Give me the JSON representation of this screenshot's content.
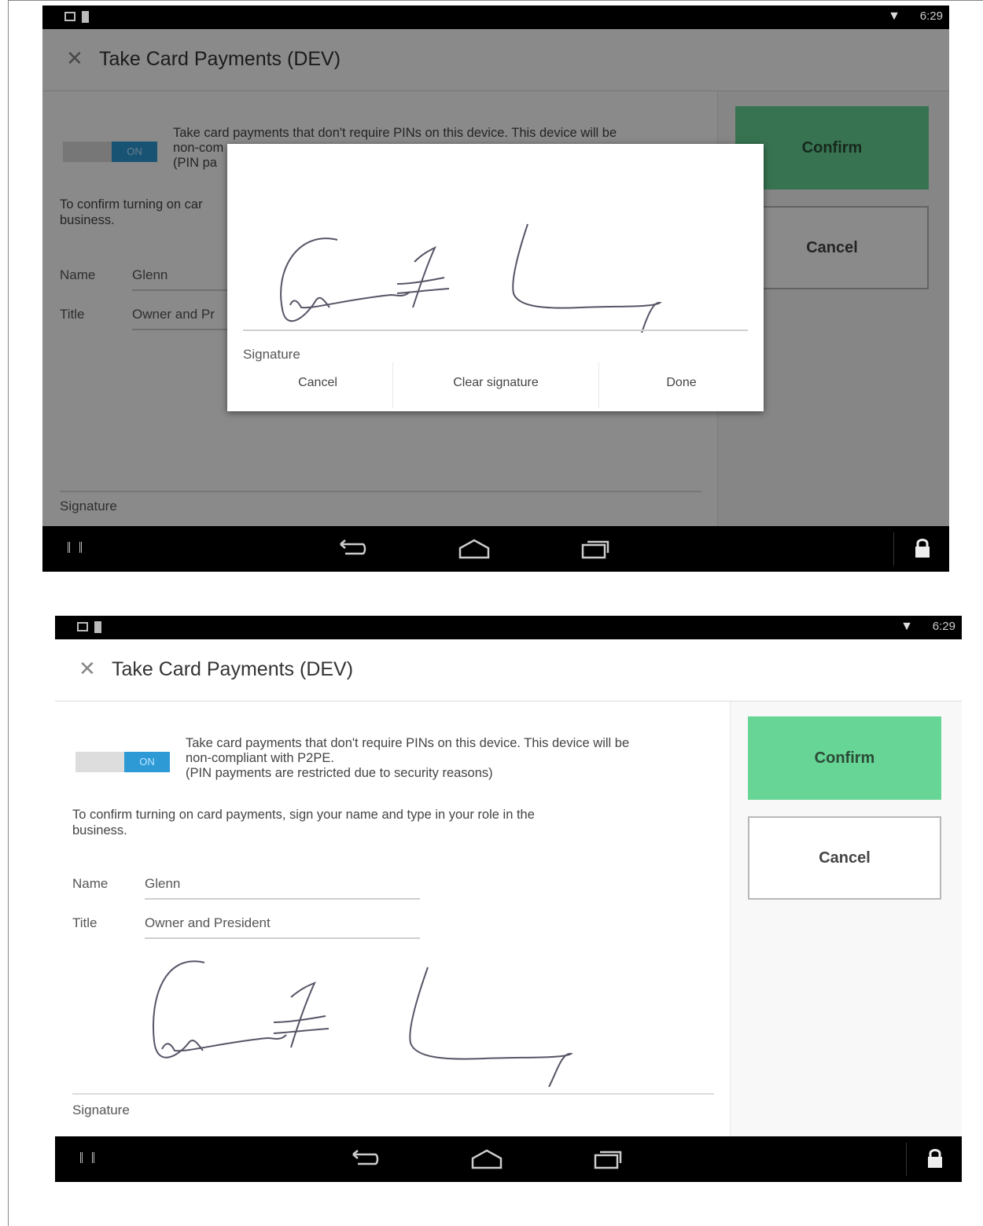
{
  "screens": {
    "top": {
      "status": {
        "time": "6:29"
      },
      "appbar": {
        "title": "Take Card Payments (DEV)"
      },
      "toggle": {
        "label": "ON"
      },
      "notice_fragment": "Take card payments that don't require PINs on this device. This device will be",
      "notice_line2": "non-com",
      "notice_line3": "(PIN pa",
      "instructions_fragment": "To confirm turning on car",
      "instructions_line2": "business.",
      "name": {
        "label": "Name",
        "value": "Glenn"
      },
      "title_field": {
        "label": "Title",
        "value": "Owner and Pr"
      },
      "signature_label": "Signature",
      "buttons": {
        "confirm": "Confirm",
        "cancel": "Cancel"
      },
      "dialog": {
        "signature_label": "Signature",
        "cancel": "Cancel",
        "clear": "Clear signature",
        "done": "Done"
      }
    },
    "bottom": {
      "status": {
        "time": "6:29"
      },
      "appbar": {
        "title": "Take Card Payments (DEV)"
      },
      "toggle": {
        "label": "ON"
      },
      "notice": {
        "line1": "Take card payments that don't require PINs on this device. This device will be",
        "line2": "non-compliant with P2PE.",
        "line3": "(PIN payments are restricted due to security reasons)"
      },
      "instructions": {
        "line1": "To confirm turning on card payments, sign your name and type in your role in the",
        "line2": "business."
      },
      "name": {
        "label": "Name",
        "value": "Glenn"
      },
      "title_field": {
        "label": "Title",
        "value": "Owner and President"
      },
      "signature_label": "Signature",
      "buttons": {
        "confirm": "Confirm",
        "cancel": "Cancel"
      }
    }
  },
  "colors": {
    "confirm_green": "#66d596",
    "toggle_blue": "#2d9ad6",
    "status_bar": "#000000",
    "nav_bar": "#000000"
  },
  "icons": [
    "close-icon",
    "wifi-icon",
    "back-icon",
    "home-icon",
    "recents-icon",
    "lock-icon",
    "keyboard-icon"
  ]
}
